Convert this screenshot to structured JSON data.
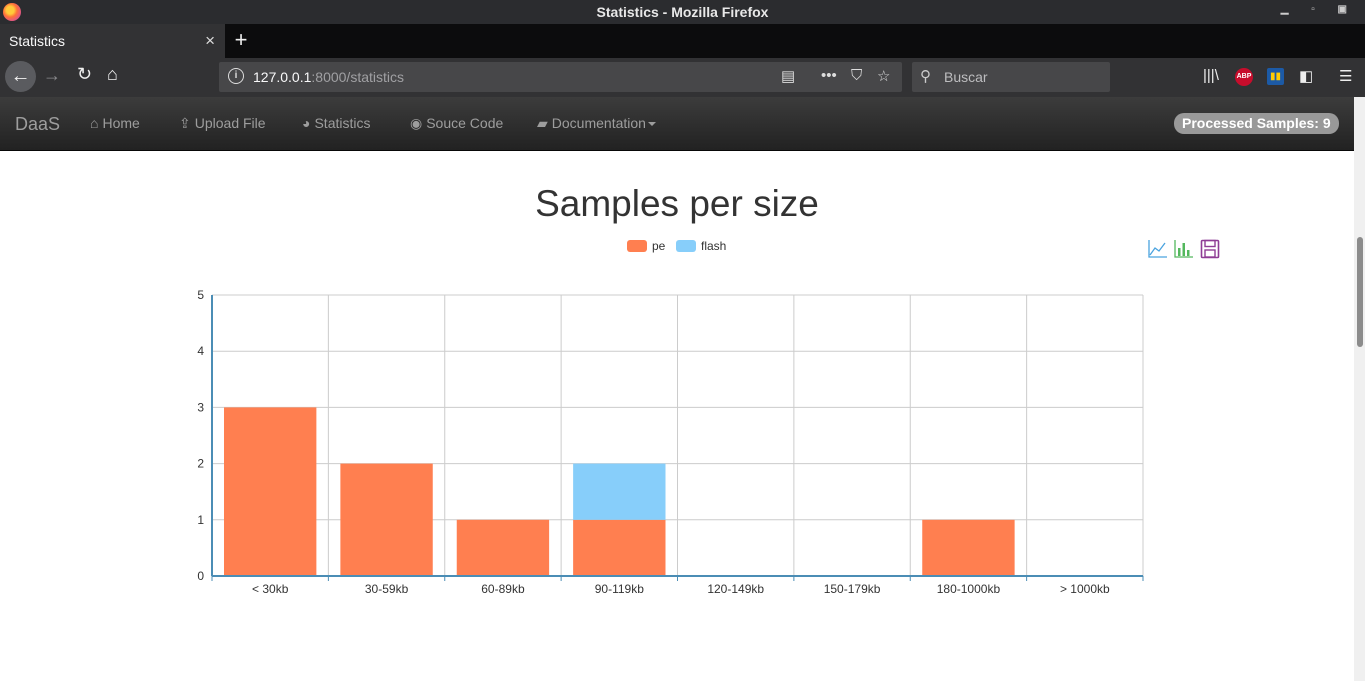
{
  "window": {
    "title": "Statistics - Mozilla Firefox"
  },
  "tab": {
    "title": "Statistics",
    "close": "×",
    "new_tab": "+"
  },
  "toolbar": {
    "url_host": "127.0.0.1",
    "url_rest": ":8000/statistics",
    "search_placeholder": "Buscar",
    "abp_label": "ABP"
  },
  "app_nav": {
    "brand": "DaaS",
    "items": [
      {
        "label": "Home",
        "icon": "home-icon"
      },
      {
        "label": "Upload File",
        "icon": "upload-icon"
      },
      {
        "label": "Statistics",
        "icon": "pie-chart-icon"
      },
      {
        "label": "Souce Code",
        "icon": "github-icon"
      },
      {
        "label": "Documentation",
        "icon": "book-icon"
      }
    ],
    "badge": "Processed Samples: 9"
  },
  "chart_data": {
    "type": "bar",
    "stacked": true,
    "title": "Samples per size",
    "categories": [
      "< 30kb",
      "30-59kb",
      "60-89kb",
      "90-119kb",
      "120-149kb",
      "150-179kb",
      "180-1000kb",
      "> 1000kb"
    ],
    "series": [
      {
        "name": "pe",
        "values": [
          3,
          2,
          1,
          1,
          0,
          0,
          1,
          0
        ],
        "color": "#ff7f50"
      },
      {
        "name": "flash",
        "values": [
          0,
          0,
          0,
          1,
          0,
          0,
          0,
          0
        ],
        "color": "#87cefa"
      }
    ],
    "ylim": [
      0,
      5
    ],
    "yticks": [
      0,
      1,
      2,
      3,
      4,
      5
    ],
    "grid": true,
    "legend": "top-center",
    "toolbox_icons": [
      "line-chart-icon",
      "bar-chart-icon",
      "save-icon"
    ]
  }
}
